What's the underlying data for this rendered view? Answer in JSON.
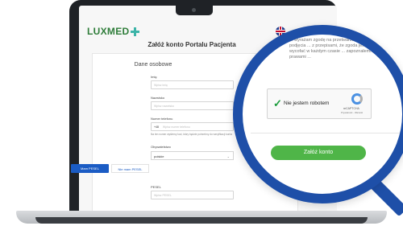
{
  "app": {
    "logo_text": "LUXMED",
    "brand_color": "#2f7d3a"
  },
  "page": {
    "title": "Załóż konto Portalu Pacjenta",
    "language_flag_icon": "uk-flag-icon"
  },
  "form": {
    "section_title": "Dane osobowe",
    "fields": {
      "first_name": {
        "label": "Imię",
        "placeholder": "Wpisz imię"
      },
      "last_name": {
        "label": "Nazwisko",
        "placeholder": "Wpisz nazwisko"
      },
      "phone": {
        "label": "Numer telefonu",
        "prefix": "+48",
        "placeholder": "Wpisz numer telefonu",
        "hint": "Na ten numer wyślemy kod, który będzie potrzebny do weryfikacji konta"
      },
      "citizenship": {
        "label": "Obywatelstwo",
        "value": "polskie"
      },
      "pesel": {
        "label": "PESEL",
        "placeholder": "Wpisz PESEL"
      }
    },
    "pesel_toggle": {
      "has_pesel": "Mam PESEL",
      "no_pesel": "Nie mam PESEL"
    }
  },
  "magnifier": {
    "consent_text": "... wyrażam zgodę na przetwarzanie moich danych osobowych w celu podjęcia ... z przepisami, że zgoda jest dobrowolna i że mam prawo ją wycofać w każdym czasie ... zapoznałem/am się z przysługującymi mi prawami ...",
    "recaptcha": {
      "label": "Nie jestem robotem",
      "brand": "reCAPTCHA",
      "links": "Prywatność - Warunki",
      "checked_color": "#1a9b3b"
    },
    "submit_label": "Załóż konto",
    "submit_color": "#4fb548",
    "ring_color": "#1e4fa8"
  }
}
